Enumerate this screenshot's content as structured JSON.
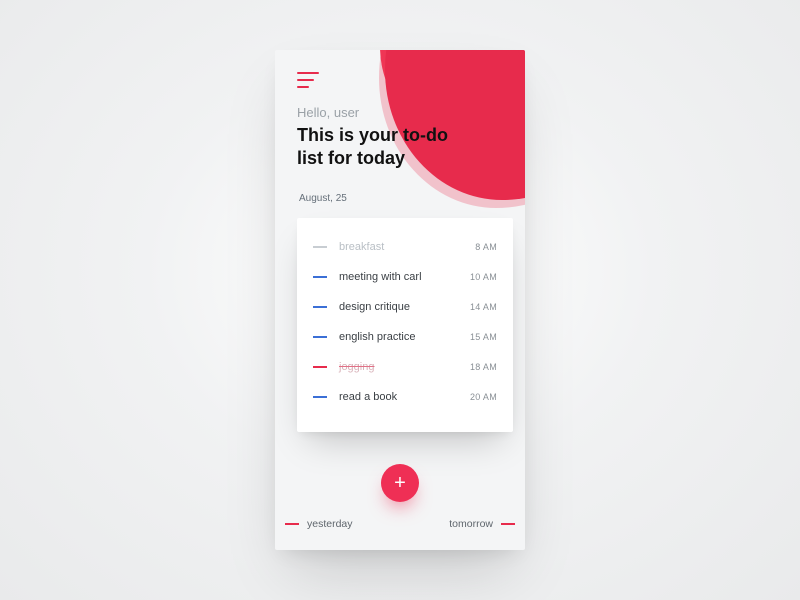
{
  "header": {
    "greeting": "Hello, user",
    "title": "This is your to-do list for today",
    "date": "August, 25"
  },
  "tasks": [
    {
      "label": "breakfast",
      "time": "8 AM",
      "style": "faded",
      "tick": "grey"
    },
    {
      "label": "meeting with carl",
      "time": "10 AM",
      "style": "normal",
      "tick": "blue"
    },
    {
      "label": "design critique",
      "time": "14 AM",
      "style": "normal",
      "tick": "blue"
    },
    {
      "label": "english practice",
      "time": "15 AM",
      "style": "normal",
      "tick": "blue"
    },
    {
      "label": "jogging",
      "time": "18 AM",
      "style": "struck",
      "tick": "red"
    },
    {
      "label": "read a book",
      "time": "20 AM",
      "style": "normal",
      "tick": "blue"
    }
  ],
  "fab": {
    "glyph": "+"
  },
  "footer": {
    "prev": "yesterday",
    "next": "tomorrow"
  },
  "colors": {
    "accent": "#e72b4c",
    "blue": "#3b6fd6"
  }
}
